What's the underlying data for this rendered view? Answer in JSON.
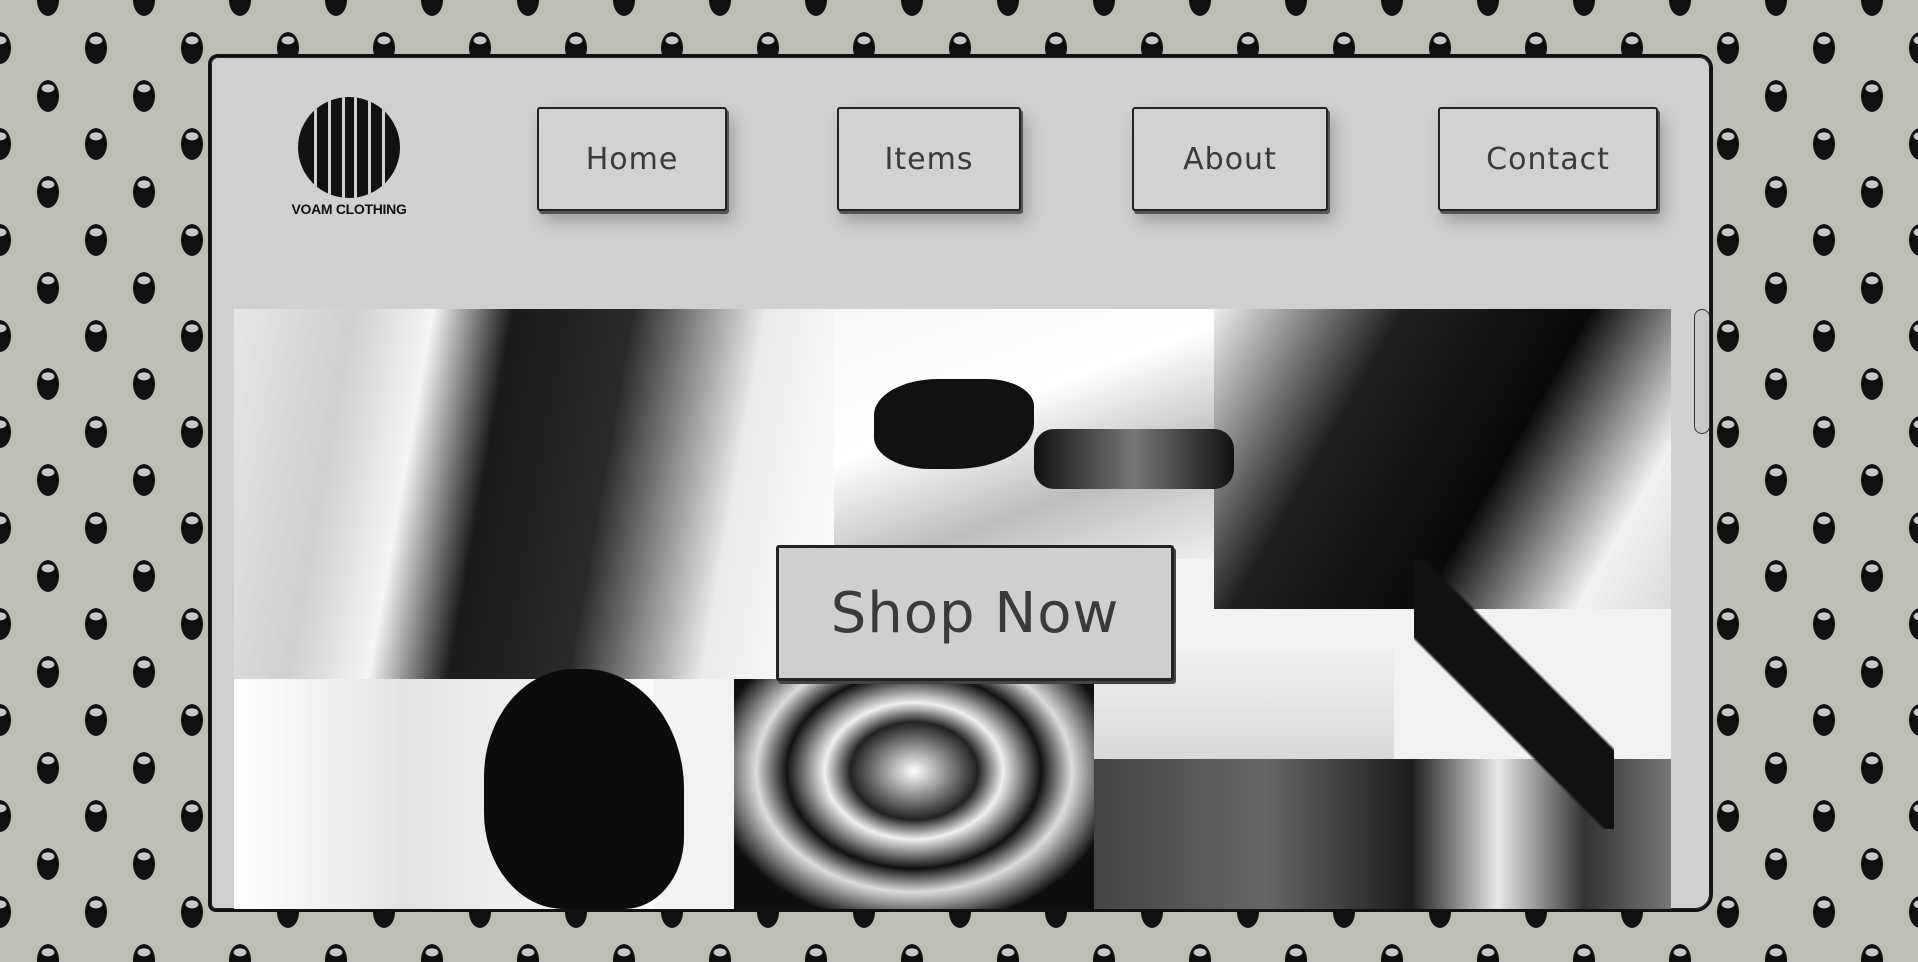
{
  "brand": {
    "name": "VOAM CLOTHING",
    "logo_icon": "voam-circle-logo-icon"
  },
  "nav": {
    "items": [
      {
        "label": "Home"
      },
      {
        "label": "Items"
      },
      {
        "label": "About"
      },
      {
        "label": "Contact"
      }
    ]
  },
  "hero": {
    "cta_label": "Shop Now",
    "collage_icon": "fashion-collage-image"
  },
  "colors": {
    "page_background": "#bebeb9",
    "window_background": "#d0d0d0",
    "button_background": "#d2d2d2",
    "text": "#3a3a3a",
    "outline": "#111111"
  }
}
